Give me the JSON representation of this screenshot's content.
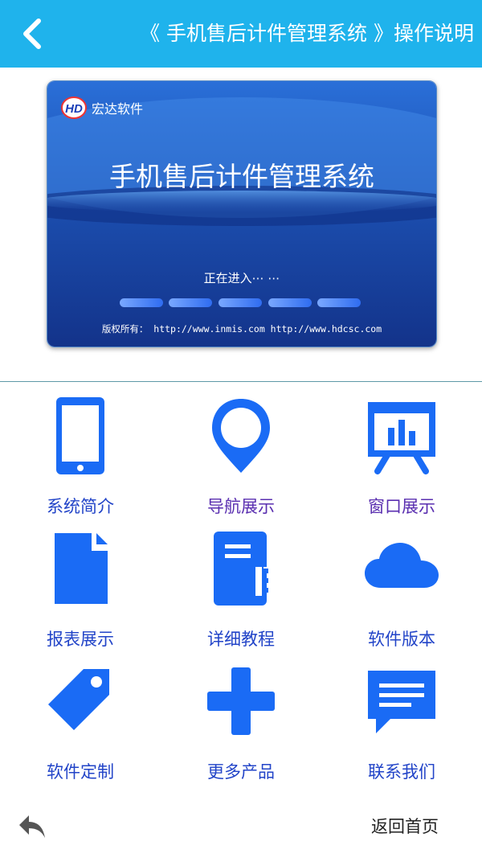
{
  "header": {
    "title": "《 手机售后计件管理系统 》操作说明"
  },
  "banner": {
    "brand": "宏达软件",
    "logo_letters": "HD",
    "headline": "手机售后计件管理系统",
    "status": "正在进入⋯ ⋯",
    "copyright": "版权所有： http://www.inmis.com http://www.hdcsc.com"
  },
  "menu": [
    {
      "label": "系统简介",
      "icon": "phone-icon"
    },
    {
      "label": "导航展示",
      "icon": "location-pin-icon"
    },
    {
      "label": "窗口展示",
      "icon": "presentation-board-icon"
    },
    {
      "label": "报表展示",
      "icon": "document-icon"
    },
    {
      "label": "详细教程",
      "icon": "notebook-icon"
    },
    {
      "label": "软件版本",
      "icon": "cloud-icon"
    },
    {
      "label": "软件定制",
      "icon": "tag-icon"
    },
    {
      "label": "更多产品",
      "icon": "plus-icon"
    },
    {
      "label": "联系我们",
      "icon": "message-icon"
    }
  ],
  "footer": {
    "home_label": "返回首页"
  },
  "colors": {
    "topbar": "#1fb3ec",
    "icon": "#1a6bf5",
    "label": "#2244c8"
  }
}
